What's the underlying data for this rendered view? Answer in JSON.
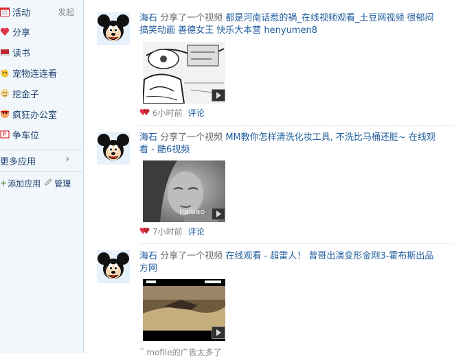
{
  "sidebar": {
    "items": [
      {
        "label": "活动",
        "extra": "发起",
        "icon": "calendar-icon"
      },
      {
        "label": "分享",
        "icon": "heart-icon"
      },
      {
        "label": "读书",
        "icon": "book-icon"
      },
      {
        "label": "宠物连连看",
        "icon": "pet-icon"
      },
      {
        "label": "挖金子",
        "icon": "gold-icon"
      },
      {
        "label": "疯狂办公室",
        "icon": "office-icon"
      },
      {
        "label": "争车位",
        "icon": "car-icon"
      }
    ],
    "more_apps": "更多应用",
    "add_app": "添加应用",
    "manage": "管理"
  },
  "feed": [
    {
      "user": "海石",
      "action": "分享了一个视频",
      "title_line1": "都是河南话惹的祸_在线视频观看_土豆网视频 很郁闷",
      "title_line2": "搞笑动画 善德女王 快乐大本营 henyumen8",
      "time": "6小时前",
      "comment": "评论",
      "thumb": "cartoon"
    },
    {
      "user": "海石",
      "action": "分享了一个视频",
      "title_line1": "MM教你怎样清洗化妆工具, 不洗比马桶还脏~ 在线观",
      "title_line2": "看 - 酷6视频",
      "time": "7小时前",
      "comment": "评论",
      "thumb": "face",
      "thumb_watermark": "haibao"
    },
    {
      "user": "海石",
      "action": "分享了一个视频",
      "title_line1": "在线观看 - 超雷人！ 曾哥出演变形金刚3-霍布斯出品",
      "title_line2": "方网",
      "thumb": "desert",
      "partial_text": "mofile的广告太多了"
    }
  ],
  "colors": {
    "link": "#1c5a9c",
    "sidebar_bg": "#f2f7fc",
    "muted": "#888888"
  }
}
